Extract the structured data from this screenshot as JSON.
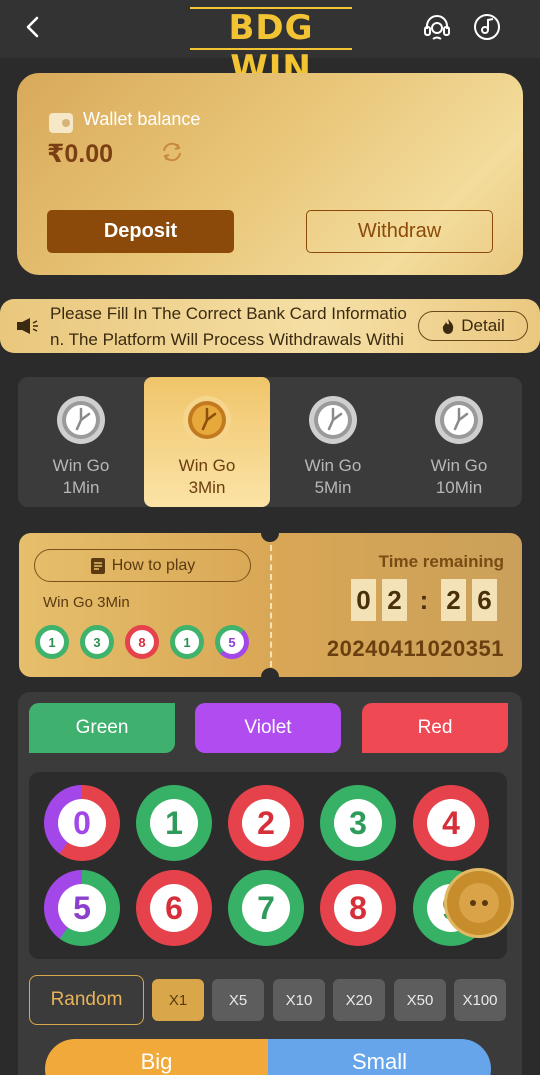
{
  "header": {
    "logo": "BDG WIN"
  },
  "wallet": {
    "label": "Wallet balance",
    "amount": "₹0.00",
    "deposit_label": "Deposit",
    "withdraw_label": "Withdraw"
  },
  "notice": {
    "line1": "Please Fill In The Correct Bank Card Informatio",
    "line2": "n. The Platform Will Process Withdrawals Withi",
    "detail_label": "Detail"
  },
  "tabs": [
    {
      "line1": "Win Go",
      "line2": "1Min",
      "active": false
    },
    {
      "line1": "Win Go",
      "line2": "3Min",
      "active": true
    },
    {
      "line1": "Win Go",
      "line2": "5Min",
      "active": false
    },
    {
      "line1": "Win Go",
      "line2": "10Min",
      "active": false
    }
  ],
  "ticket": {
    "how_to_play": "How to play",
    "game_name": "Win Go 3Min",
    "recent_results": [
      "1",
      "3",
      "8",
      "1",
      "5"
    ],
    "time_label": "Time remaining",
    "timer": [
      "0",
      "2",
      ":",
      "2",
      "6"
    ],
    "period": "20240411020351"
  },
  "colors": {
    "green_label": "Green",
    "violet_label": "Violet",
    "red_label": "Red",
    "green_hex": "#40b06f",
    "violet_hex": "#b04cf0",
    "red_hex": "#ef4a54"
  },
  "numbers": [
    "0",
    "1",
    "2",
    "3",
    "4",
    "5",
    "6",
    "7",
    "8",
    "9"
  ],
  "random_label": "Random",
  "multipliers": [
    "X1",
    "X5",
    "X10",
    "X20",
    "X50",
    "X100"
  ],
  "big_label": "Big",
  "small_label": "Small"
}
